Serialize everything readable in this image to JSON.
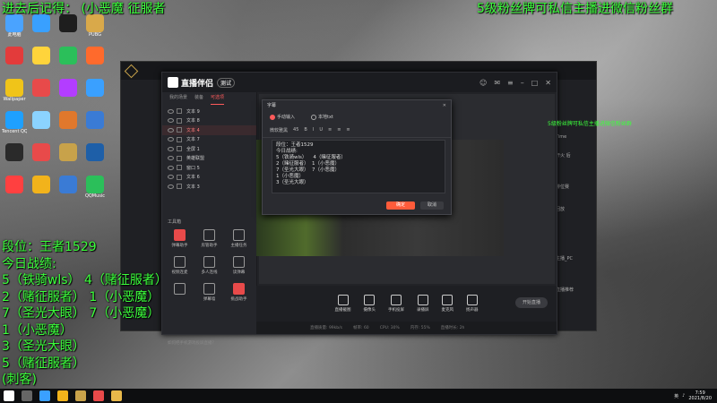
{
  "overlay": {
    "top_left": "进去后记得：   (小恶魔 征服者",
    "top_right": "5级粉丝牌可私信主播进微信粉丝群",
    "left_lines": [
      "段位：王者1529",
      "今日战绩:",
      "5（铁骑wls）  4（赌征服者）",
      "2（赌征服者）  1（小恶魔）",
      "7（圣光大眼）  7（小恶魔）",
      "1（小恶魔）",
      "3（圣光大眼）",
      "5（赌征服者）",
      "(刺客)"
    ]
  },
  "desktop_icons": [
    {
      "label": "此电脑",
      "icon": "computer-icon",
      "color": "#4aa3ff"
    },
    {
      "label": "",
      "icon": "app-icon",
      "color": "#e33b3b"
    },
    {
      "label": "Wallpaper",
      "icon": "wallpaper-icon",
      "color": "#f0c419"
    },
    {
      "label": "Tencent QQ",
      "icon": "qq-icon",
      "color": "#1ea0ff"
    },
    {
      "label": "",
      "icon": "app-icon",
      "color": "#2a2a2a"
    },
    {
      "label": "",
      "icon": "app-icon",
      "color": "#ff4040"
    },
    {
      "label": "",
      "icon": "app-icon",
      "color": "#39a0ff"
    },
    {
      "label": "",
      "icon": "app-icon",
      "color": "#ffd43b"
    },
    {
      "label": "",
      "icon": "app-icon",
      "color": "#e84a4a"
    },
    {
      "label": "",
      "icon": "app-icon",
      "color": "#8bd3ff"
    },
    {
      "label": "",
      "icon": "app-icon",
      "color": "#e84a4a"
    },
    {
      "label": "",
      "icon": "app-icon",
      "color": "#f2b31b"
    },
    {
      "label": "",
      "icon": "app-icon",
      "color": "#1e1e1e"
    },
    {
      "label": "",
      "icon": "app-icon",
      "color": "#2bbf5a"
    },
    {
      "label": "",
      "icon": "app-icon",
      "color": "#b33dff"
    },
    {
      "label": "",
      "icon": "app-icon",
      "color": "#e0782c"
    },
    {
      "label": "",
      "icon": "app-icon",
      "color": "#c8a24a"
    },
    {
      "label": "",
      "icon": "app-icon",
      "color": "#3a7bd5"
    },
    {
      "label": "PUBG",
      "icon": "pubg-icon",
      "color": "#d9a94a"
    },
    {
      "label": "",
      "icon": "app-icon",
      "color": "#ff6a2c"
    },
    {
      "label": "",
      "icon": "app-icon",
      "color": "#3aa0ff"
    },
    {
      "label": "",
      "icon": "app-icon",
      "color": "#3a7bd5"
    },
    {
      "label": "",
      "icon": "app-icon",
      "color": "#1e5fa8"
    },
    {
      "label": "QQMusic",
      "icon": "music-icon",
      "color": "#2bbf5a"
    }
  ],
  "main_window": {
    "app_name": "直播伴侣",
    "version_badge": "测试",
    "left_tabs": [
      "我的场景",
      "装备",
      "可选项"
    ],
    "sources": [
      {
        "name": "文本 9",
        "selected": false
      },
      {
        "name": "文本 8",
        "selected": false
      },
      {
        "name": "文本 4",
        "selected": true
      },
      {
        "name": "文本 7",
        "selected": false
      },
      {
        "name": "全屏 1",
        "selected": false
      },
      {
        "name": "英雄联盟",
        "selected": false
      },
      {
        "name": "窗口 5",
        "selected": false
      },
      {
        "name": "文本 6",
        "selected": false
      },
      {
        "name": "文本 3",
        "selected": false
      }
    ],
    "tools_title": "工具箱",
    "tools": [
      {
        "label": "弹幕助手",
        "red": true
      },
      {
        "label": "房管助手",
        "red": false
      },
      {
        "label": "主播任务",
        "red": false
      },
      {
        "label": "视频连麦",
        "red": false
      },
      {
        "label": "多人连线",
        "red": false
      },
      {
        "label": "读弹幕",
        "red": false
      },
      {
        "label": "",
        "red": false
      },
      {
        "label": "弹幕墙",
        "red": false
      },
      {
        "label": "挑战助手",
        "red": true
      }
    ],
    "ask_text": "如何把手机游戏投屏直播?",
    "bottom_buttons": [
      "直播截图",
      "摄像头",
      "手机投屏",
      "录播屏",
      "麦克风",
      "扬声器"
    ],
    "start_live": "开始直播",
    "status": [
      "直播质量: 99kb/s",
      "帧率: 60",
      "CPU: 30%",
      "内存: 55%",
      "直播时长: 2h"
    ],
    "preview_overlay": "5级粉丝牌可私信主播进微信粉丝群"
  },
  "dialog": {
    "title": "字幕",
    "mode_manual": "手动输入",
    "mode_file": "本地txt",
    "font": "微软雅黑",
    "size": "45",
    "content": [
      "段位：王者1529",
      "今日战绩:",
      "5（铁骑wls）    4（赌征服者）",
      "2（赌征服者）  1（小恶魔）",
      "7（圣光大眼）  7（小恶魔）",
      "1（小恶魔）",
      "3（圣光大眼）"
    ],
    "ok": "确定",
    "cancel": "取消"
  },
  "side_texts": [
    "Time",
    "开火 后",
    "排位赛",
    "回放",
    "主播_PC",
    "直播推荐",
    "推荐 WiFi"
  ],
  "taskbar": {
    "time": "7:59",
    "date": "2021/8/20",
    "lang": "英"
  }
}
